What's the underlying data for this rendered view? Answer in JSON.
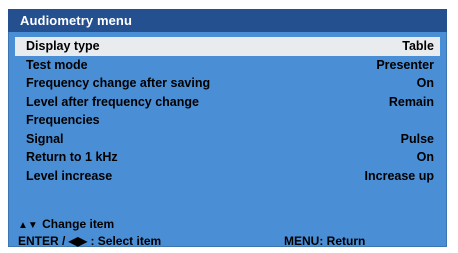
{
  "window": {
    "title": "Audiometry menu"
  },
  "menu": {
    "items": [
      {
        "label": "Display type",
        "value": "Table",
        "selected": true
      },
      {
        "label": "Test mode",
        "value": "Presenter"
      },
      {
        "label": "Frequency change after saving",
        "value": "On"
      },
      {
        "label": "Level after frequency change",
        "value": "Remain"
      },
      {
        "label": "Frequencies",
        "value": ""
      },
      {
        "label": "Signal",
        "value": "Pulse"
      },
      {
        "label": "Return to 1 kHz",
        "value": "On"
      },
      {
        "label": "Level increase",
        "value": "Increase up"
      }
    ]
  },
  "footer": {
    "up_down_glyph": "▲▼",
    "change_item": "Change item",
    "enter_hint": "ENTER / ◀▶ : Select item",
    "menu_return": "MENU: Return"
  },
  "colors": {
    "panel_bg": "#4a8fd6",
    "title_bg": "#24508f",
    "selected_bg": "#e9ecef"
  }
}
